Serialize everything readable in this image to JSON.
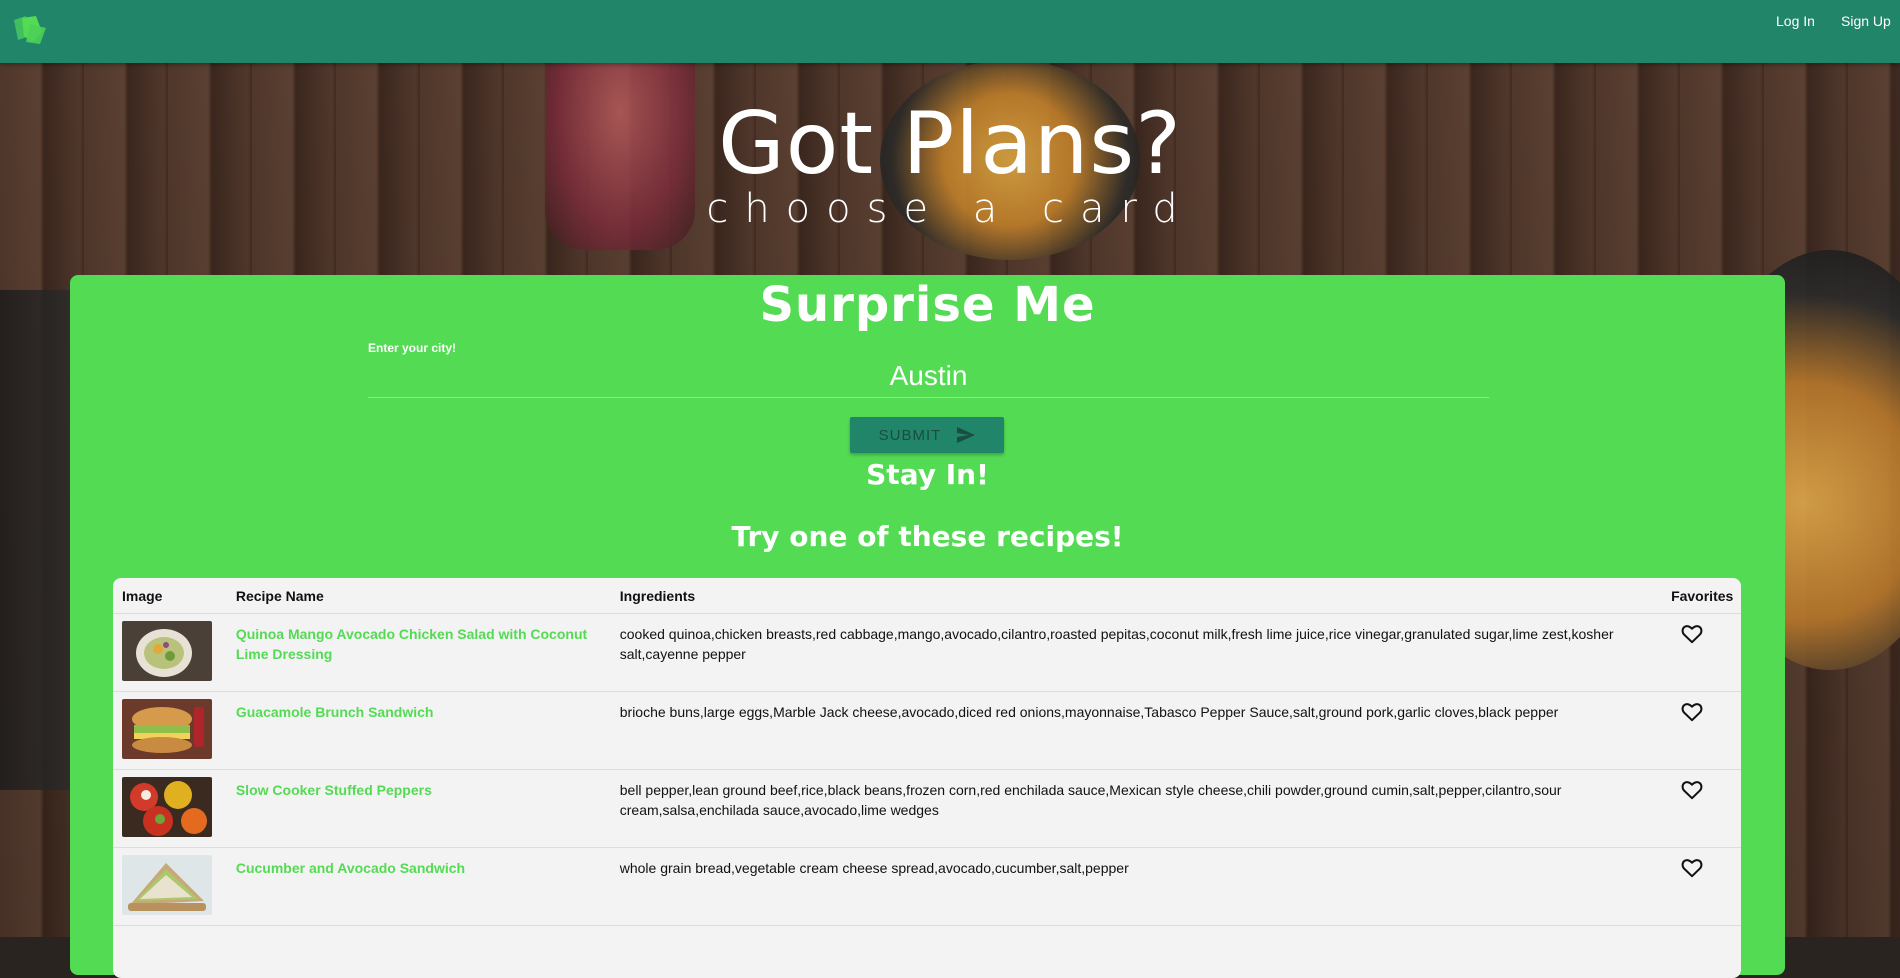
{
  "nav": {
    "login": "Log In",
    "signup": "Sign Up"
  },
  "hero": {
    "title": "Got Plans?",
    "subtitle": "choose a card"
  },
  "card": {
    "title": "Surprise Me",
    "city_label": "Enter your city!",
    "city_value": "Austin",
    "submit_label": "SUBMIT",
    "stay_in": "Stay In!",
    "try_recipes": "Try one of these recipes!"
  },
  "table": {
    "headers": [
      "Image",
      "Recipe Name",
      "Ingredients",
      "Favorites"
    ],
    "rows": [
      {
        "name": "Quinoa Mango Avocado Chicken Salad with Coconut Lime Dressing",
        "ingredients": "cooked quinoa,chicken breasts,red cabbage,mango,avocado,cilantro,roasted pepitas,coconut milk,fresh lime juice,rice vinegar,granulated sugar,lime zest,kosher salt,cayenne pepper"
      },
      {
        "name": "Guacamole Brunch Sandwich",
        "ingredients": "brioche buns,large eggs,Marble Jack cheese,avocado,diced red onions,mayonnaise,Tabasco Pepper Sauce,salt,ground pork,garlic cloves,black pepper"
      },
      {
        "name": "Slow Cooker Stuffed Peppers",
        "ingredients": "bell pepper,lean ground beef,rice,black beans,frozen corn,red enchilada sauce,Mexican style cheese,chili powder,ground cumin,salt,pepper,cilantro,sour cream,salsa,enchilada sauce,avocado,lime wedges"
      },
      {
        "name": "Cucumber and Avocado Sandwich",
        "ingredients": "whole grain bread,vegetable cream cheese spread,avocado,cucumber,salt,pepper"
      }
    ]
  },
  "colors": {
    "topbar": "#21856a",
    "card": "#53db53",
    "link": "#53db53"
  },
  "icons": {
    "logo": "logo-icon",
    "send": "send-icon",
    "favorite": "heart-outline-icon"
  }
}
